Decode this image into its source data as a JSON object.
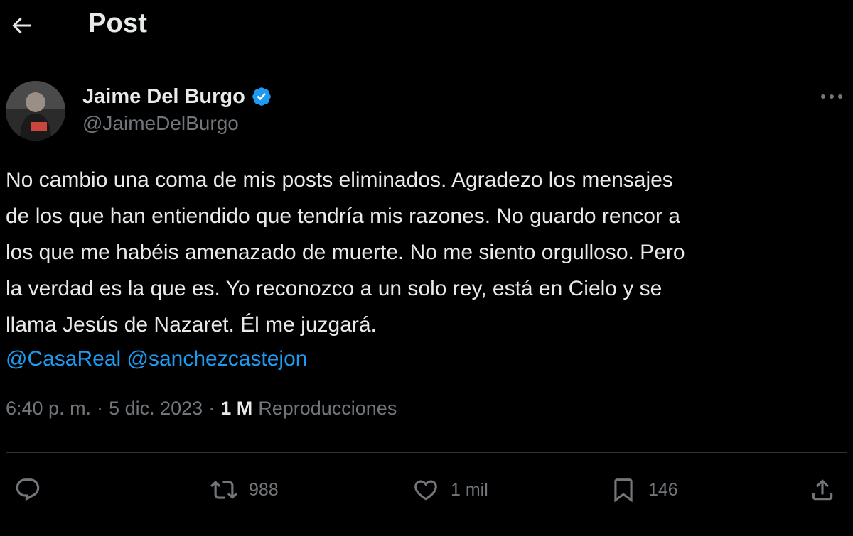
{
  "header": {
    "title": "Post",
    "back_icon": "arrow-left-icon"
  },
  "author": {
    "display_name": "Jaime Del Burgo",
    "handle": "@JaimeDelBurgo",
    "verified_icon": "verified-badge-icon",
    "verified_color": "#1d9bf0"
  },
  "tweet": {
    "lines": [
      "No cambio una coma de mis posts eliminados. Agradezo los mensajes",
      "de los que han entiendido que tendría mis razones. No guardo rencor a",
      "los que me habéis amenazado de muerte. No me siento orgulloso. Pero",
      "la verdad es la que es. Yo reconozco a un solo rey, está en Cielo y se",
      "llama Jesús de Nazaret. Él me juzgará."
    ],
    "mentions": [
      "@CasaReal",
      "@sanchezcastejon"
    ]
  },
  "meta": {
    "time": "6:40 p. m.",
    "sep1": "·",
    "date": "5 dic. 2023",
    "sep2": "·",
    "views_count": "1 M",
    "views_label": "Reproducciones"
  },
  "actions": {
    "reply": {
      "icon": "reply-icon",
      "count": ""
    },
    "repost": {
      "icon": "repost-icon",
      "count": "988"
    },
    "like": {
      "icon": "heart-icon",
      "count": "1 mil"
    },
    "bookmark": {
      "icon": "bookmark-icon",
      "count": "146"
    },
    "share": {
      "icon": "share-icon",
      "count": ""
    }
  },
  "colors": {
    "background": "#000000",
    "text": "#e7e9ea",
    "muted": "#71767b",
    "link": "#1d9bf0",
    "divider": "#2f3336"
  }
}
